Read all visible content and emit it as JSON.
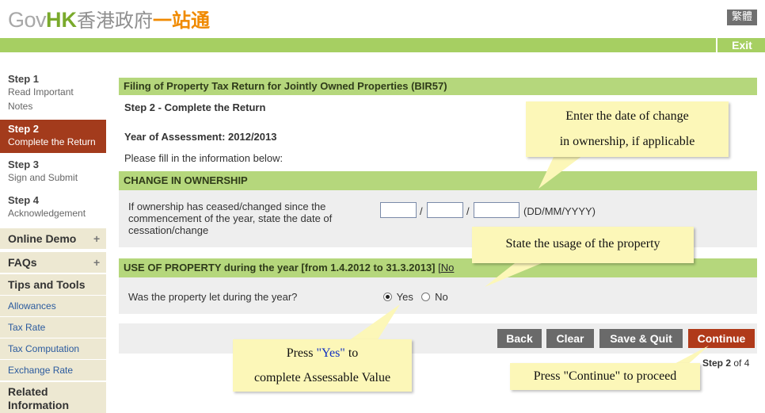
{
  "header": {
    "logo_gov": "Gov",
    "logo_hk": "HK",
    "logo_cn_a": "香港政府",
    "logo_cn_b": "一站通",
    "lang_button": "繁體",
    "exit_label": "Exit"
  },
  "sidebar": {
    "steps": [
      {
        "title": "Step 1",
        "sub": "Read Important",
        "sub2": "Notes"
      },
      {
        "title": "Step 2",
        "sub": "Complete the Return"
      },
      {
        "title": "Step 3",
        "sub": "Sign and Submit"
      },
      {
        "title": "Step 4",
        "sub": "Acknowledgement"
      }
    ],
    "online_demo": "Online Demo",
    "faqs": "FAQs",
    "tips_tools": "Tips and Tools",
    "links": [
      "Allowances",
      "Tax Rate",
      "Tax Computation",
      "Exchange Rate"
    ],
    "related": "Related",
    "related2": "Information",
    "plus_glyph": "+"
  },
  "main": {
    "form_title": "Filing of Property Tax Return for Jointly Owned Properties (BIR57)",
    "step_heading": "Step 2  -  Complete the Return",
    "year_label": "Year of Assessment: 2012/2013",
    "instruction": "Please fill in the information below:",
    "ownership_header": "CHANGE IN OWNERSHIP",
    "ownership_q1": "If ownership has ceased/changed since the",
    "ownership_q2": "commencement of the year, state the date of",
    "ownership_q3": "cessation/change",
    "date_sep": "/",
    "date_format": "(DD/MM/YYYY)",
    "usage_header": "USE OF PROPERTY during the year [from 1.4.2012 to 31.3.2013]",
    "usage_note": "[No",
    "usage_question": "Was the property let during the year?",
    "radio_yes": "Yes",
    "radio_no": "No",
    "buttons": {
      "back": "Back",
      "clear": "Clear",
      "save_quit": "Save & Quit",
      "continue": "Continue"
    },
    "step_counter_a": "Step 2",
    "step_counter_b": " of 4"
  },
  "callouts": {
    "date_line1": "Enter the date of change",
    "date_line2": "in ownership, if applicable",
    "usage": "State the usage of the property",
    "yes_a": "Press ",
    "yes_b": "\"Yes\"",
    "yes_c": " to",
    "yes_line2": "complete Assessable Value",
    "continue": "Press \"Continue\" to proceed"
  },
  "colors": {
    "brand_green": "#a6cf62",
    "section_green": "#b5d77c",
    "active_step": "#a33b1c",
    "continue_button": "#b03a1a",
    "callout_yellow": "#fcf7b8"
  }
}
